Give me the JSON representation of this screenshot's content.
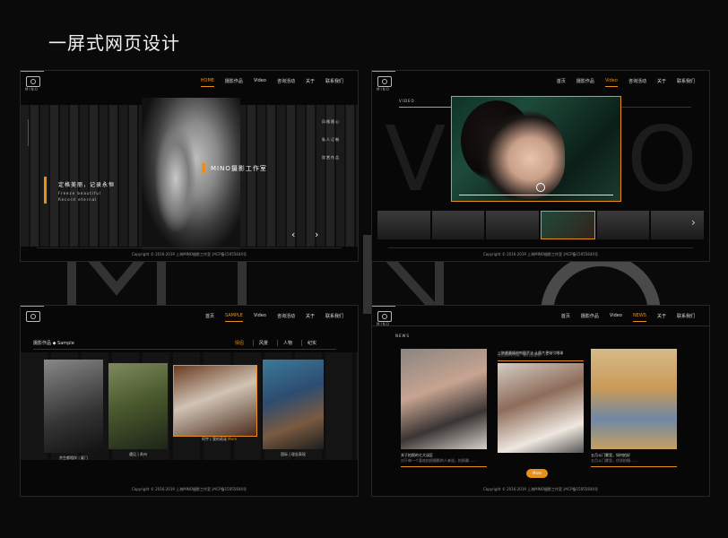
{
  "title": "一屏式网页设计",
  "bg_letters": "MINO",
  "brand": {
    "logo_text": "MINO"
  },
  "footer": "Copyright © 2016-2019 上海MINO摄影工作室    沪ICP备15055644号",
  "panel1": {
    "nav": [
      "HOME",
      "摄影作品",
      "Video",
      "咨询活动",
      "关于",
      "联系我们"
    ],
    "active_index": 0,
    "slogan": "定格美丽，记录永恒",
    "slogan_en_1": "Freeze beautiful",
    "slogan_en_2": "Record eternal",
    "studio": "MINO摄影工作室",
    "right_menu": [
      "风格随心",
      "私人订制",
      "欣赏作品"
    ],
    "prev": "‹",
    "next": "›"
  },
  "panel2": {
    "nav": [
      "首页",
      "摄影作品",
      "Video",
      "咨询活动",
      "关于",
      "联系我们"
    ],
    "active_index": 2,
    "section": "VIDEO",
    "big": "VIDEO",
    "prev": "‹",
    "next": "›"
  },
  "panel3": {
    "nav": [
      "首页",
      "SAMPLE",
      "Video",
      "咨询活动",
      "关于",
      "联系我们"
    ],
    "active_index": 1,
    "crumb": "摄影作品 ◆ Sample",
    "cats": [
      "情侣",
      "风景",
      "人物",
      "纪实"
    ],
    "cat_active": 0,
    "gallery": [
      {
        "cap": "余生都相伴  |  厦门"
      },
      {
        "cap": "遇见  |  贵州"
      },
      {
        "cap": "阿宇  |  我的萌宠",
        "more": "More"
      },
      {
        "cap": "国际  |  理念表现"
      }
    ]
  },
  "panel4": {
    "nav": [
      "首页",
      "摄影作品",
      "Video",
      "NEWS",
      "关于",
      "联系我们"
    ],
    "active_index": 3,
    "section": "NEWS",
    "cards": [
      {
        "title": "关于拍照的七大误区",
        "desc": "对于每一个喜欢拍照摄影的人来说，拍照最……"
      },
      {
        "title": "三种最最棒的构图手法 让照片更吸引眼球",
        "desc": "在拍照的时候，我们总是想……"
      },
      {
        "title": "五月斗门雾里，如何拍好",
        "desc": "五月斗门雾里，优质拍摄……"
      }
    ],
    "more": "More"
  }
}
